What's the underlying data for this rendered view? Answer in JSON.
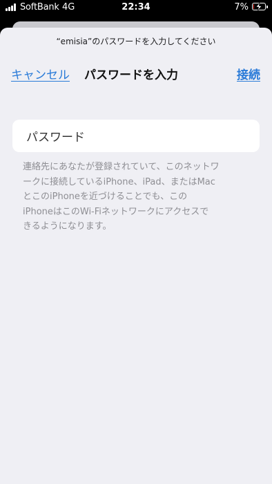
{
  "status_bar": {
    "carrier": "SoftBank",
    "network": "4G",
    "time": "22:34",
    "battery_percent": "7%",
    "battery_level": 0.07,
    "battery_color": "#ff3b30",
    "charging_icon": "bolt-icon"
  },
  "sheet": {
    "prompt": "“emisia”のパスワードを入力してください",
    "nav": {
      "cancel_label": "キャンセル",
      "title": "パスワードを入力",
      "connect_label": "接続"
    },
    "password_field": {
      "placeholder": "パスワード"
    },
    "footnote": "連絡先にあなたが登録されていて、このネットワ\nークに接続しているiPhone、iPad、またはMac\nとこのiPhoneを近づけることでも、この\niPhoneはこのWi-Fiネットワークにアクセスで\nきるようになります。"
  },
  "colors": {
    "accent": "#2a7bd8",
    "sheet_background": "#efeff4",
    "field_background": "#ffffff",
    "footnote_text": "#8e8e93"
  }
}
